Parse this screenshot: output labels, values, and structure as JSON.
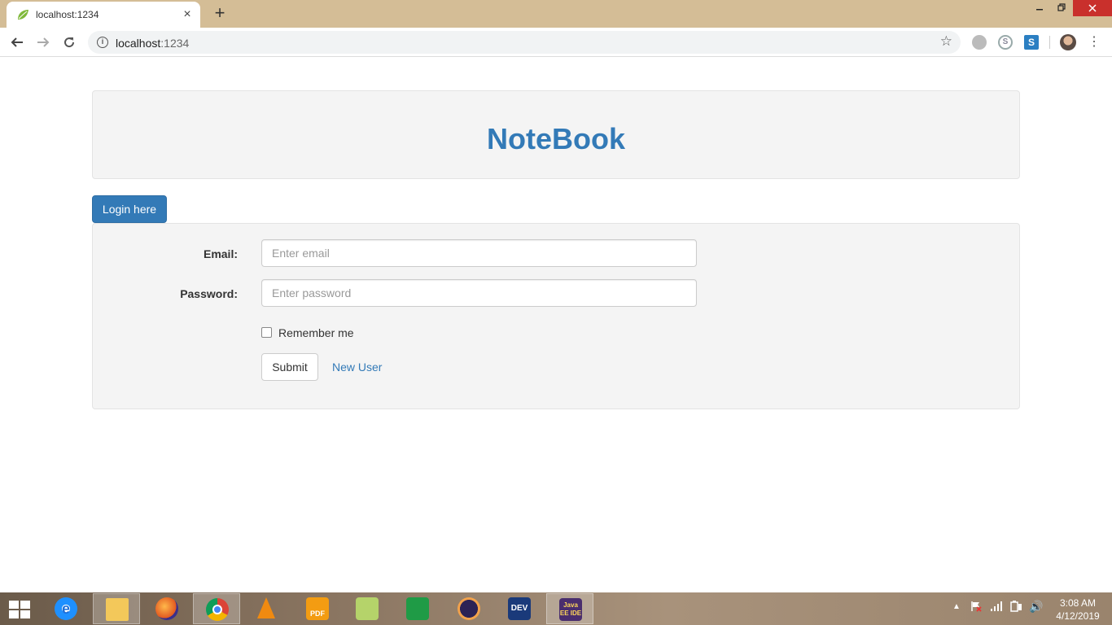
{
  "browser": {
    "tab_title": "localhost:1234",
    "url_host": "localhost",
    "url_port": ":1234",
    "new_tab_symbol": "+",
    "tab_close_symbol": "×"
  },
  "page": {
    "brand": "NoteBook",
    "login_tab_label": "Login here",
    "email_label": "Email:",
    "email_placeholder": "Enter email",
    "password_label": "Password:",
    "password_placeholder": "Enter password",
    "remember_label": "Remember me",
    "submit_label": "Submit",
    "new_user_label": "New User"
  },
  "taskbar": {
    "pdf_label": "PDF",
    "dev_label": "DEV",
    "java_label": "Java EE IDE",
    "clock_time": "3:08 AM",
    "clock_date": "4/12/2019"
  },
  "colors": {
    "primary": "#337ab7",
    "tabstrip": "#d4bd96",
    "panel_bg": "#f4f4f4"
  },
  "icons": [
    "spring-leaf-icon",
    "back-arrow-icon",
    "forward-arrow-icon",
    "reload-icon",
    "info-icon",
    "bookmark-star-icon",
    "menu-dots-icon",
    "windows-start-icon"
  ]
}
